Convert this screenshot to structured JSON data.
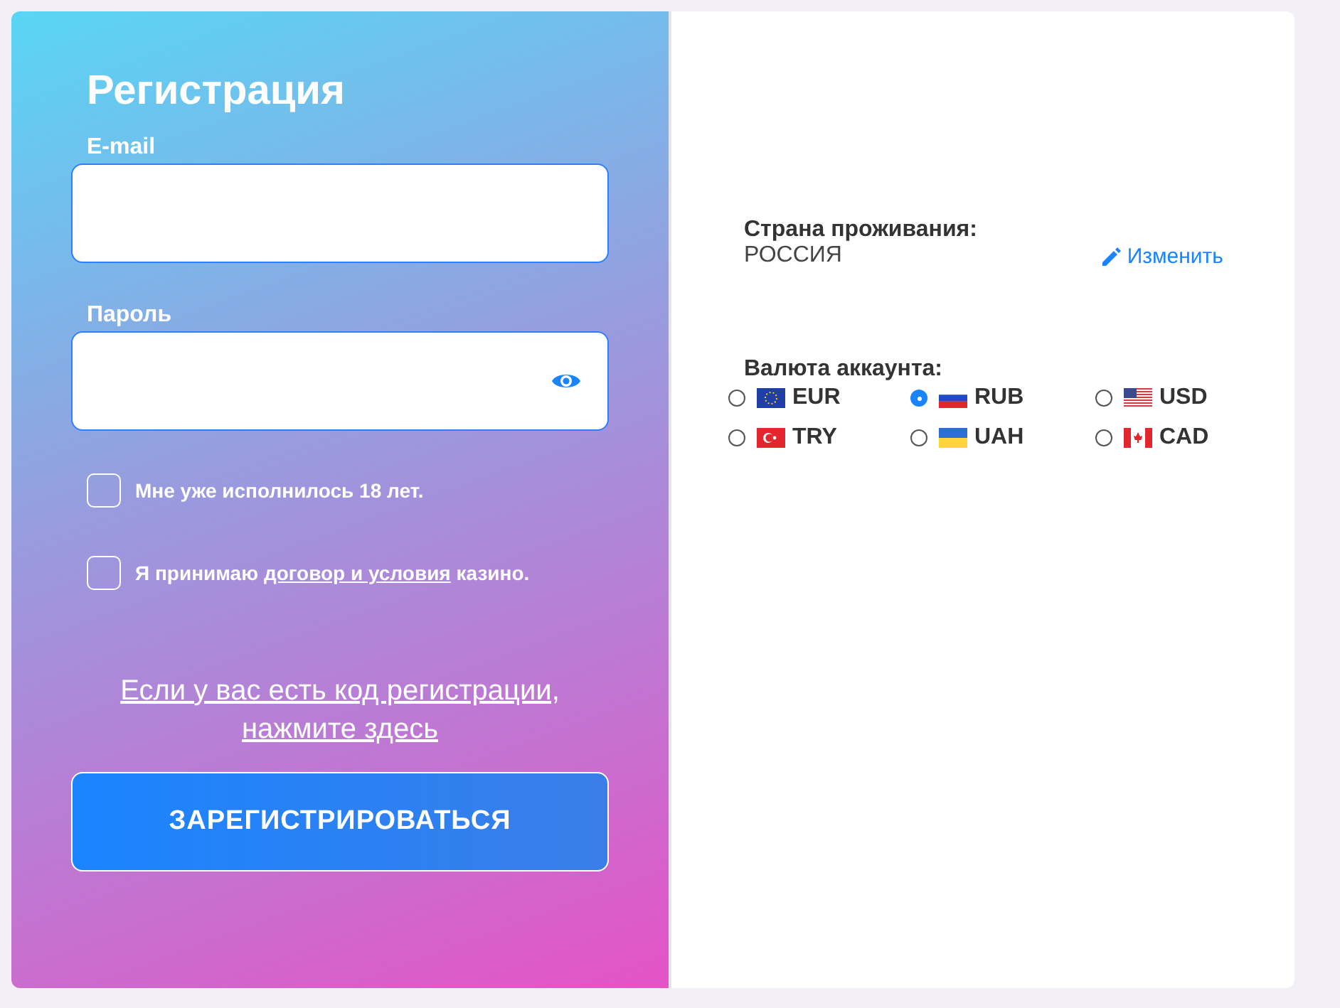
{
  "registration": {
    "title": "Регистрация",
    "fields": [
      {
        "label": "E-mail",
        "kind": "text"
      },
      {
        "label": "Пароль",
        "kind": "password"
      }
    ],
    "checkboxes": [
      {
        "checked": false,
        "text": "Мне уже исполнилось 18 лет."
      },
      {
        "checked": false,
        "text": "Я принимаю ",
        "link": "договор и условия",
        "text_after": " казино."
      }
    ],
    "promo_link": "Если у вас есть код регистрации, нажмите здесь",
    "submit": "ЗАРЕГИСТРИРОВАТЬСЯ"
  },
  "account": {
    "country_label": "Страна проживания:",
    "country": "РОССИЯ",
    "change_link": "Изменить",
    "currency_label": "Валюта аккаунта:",
    "currencies": [
      {
        "code": "EUR",
        "kind": "eu",
        "selected": false
      },
      {
        "code": "RUB",
        "kind": "ru",
        "selected": true
      },
      {
        "code": "USD",
        "kind": "us",
        "selected": false
      },
      {
        "code": "TRY",
        "kind": "tr",
        "selected": false
      },
      {
        "code": "UAH",
        "kind": "ua",
        "selected": false
      },
      {
        "code": "CAD",
        "kind": "ca",
        "selected": false
      }
    ]
  }
}
